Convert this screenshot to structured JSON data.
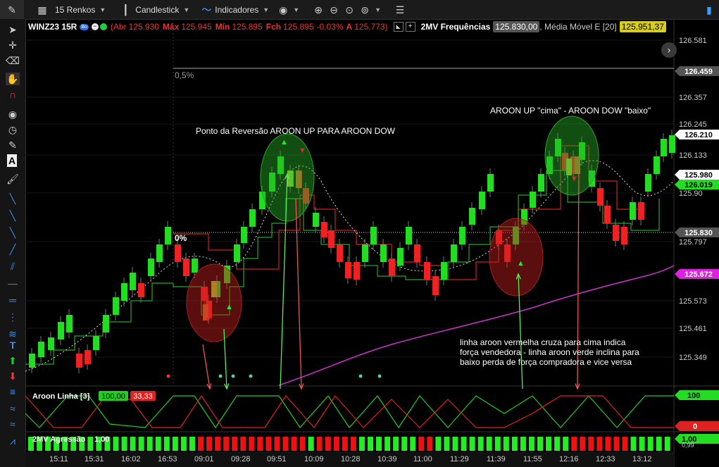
{
  "toolbar": {
    "renko_label": "15 Renkos",
    "chart_type_label": "Candlestick",
    "indicators_label": "Indicadores"
  },
  "infobar": {
    "symbol": "WINZ23 15R",
    "badge": "Bo",
    "abr_label": "(Abr",
    "abr": "125.930",
    "max_label": "Máx",
    "max": "125.945",
    "min_label": "Mín",
    "min": "125.895",
    "fch_label": "Fch",
    "fch": "125.895",
    "change": "-0,03%",
    "a_label": "A",
    "a_value": "125.773)",
    "indicator1_label": "2MV Frequências",
    "indicator1_value": "125.830,00",
    "indicator2_label": ", Média Móvel E [20]",
    "indicator2_value": "125.951,37"
  },
  "price_axis": {
    "ticks": [
      "126.581",
      "126.357",
      "126.245",
      "126.133",
      "125.90",
      "125.797",
      "125.573",
      "125.461",
      "125.349"
    ],
    "flags": [
      {
        "label": "126.459",
        "bg": "#555555",
        "fg": "#ffffff"
      },
      {
        "label": "126.210",
        "bg": "#ffffff",
        "fg": "#000000"
      },
      {
        "label": "126.019",
        "bg": "#22dd22",
        "fg": "#000000"
      },
      {
        "label": "125.980",
        "bg": "#ffffff",
        "fg": "#000000"
      },
      {
        "label": "125.830",
        "bg": "#555555",
        "fg": "#ffffff"
      },
      {
        "label": "125.672",
        "bg": "#e020e0",
        "fg": "#ffffff"
      }
    ]
  },
  "time_axis": [
    "15:11",
    "15:31",
    "16:02",
    "16:53",
    "09:01",
    "09:28",
    "09:51",
    "10:09",
    "10:28",
    "10:39",
    "11:00",
    "11:29",
    "11:39",
    "11:55",
    "12:16",
    "12:33",
    "13:12"
  ],
  "fib_labels": {
    "top": "0,5%",
    "mid": "0%"
  },
  "annotations": {
    "reversal": "Ponto da Reversão AROON UP PARA AROON DOW",
    "aroon_updown": "AROON UP \"cima\"  -  AROON DOW \"baixo\"",
    "explain_line1": "linha aroon vermelha cruza para cima indica",
    "explain_line2": "força vendedora - linha aroon verde inclina para",
    "explain_line3": "baixo perda de força compradora e vice versa"
  },
  "aroon_panel": {
    "label": "Aroon Linha [3]",
    "up_value": "100,00",
    "down_value": "33,33",
    "flag_up": "100",
    "flag_down": "0"
  },
  "agressao_panel": {
    "label": "2MV Agressão",
    "value": "1,00",
    "flag_value": "1,00",
    "axis_tick": "0,99"
  },
  "colors": {
    "bull": "#22dd22",
    "bear": "#ee2222",
    "ema": "#cc33cc",
    "aroon_up": "#22cc22",
    "aroon_down": "#dd2222"
  }
}
